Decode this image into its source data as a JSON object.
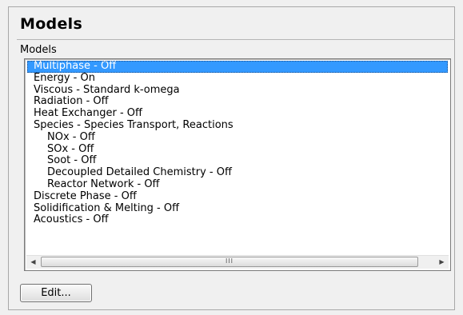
{
  "panel": {
    "title": "Models",
    "group_label": "Models"
  },
  "models_list": {
    "items": [
      {
        "label": "Multiphase - Off",
        "indent": 0,
        "selected": true
      },
      {
        "label": "Energy - On",
        "indent": 0,
        "selected": false
      },
      {
        "label": "Viscous - Standard k-omega",
        "indent": 0,
        "selected": false
      },
      {
        "label": "Radiation - Off",
        "indent": 0,
        "selected": false
      },
      {
        "label": "Heat Exchanger - Off",
        "indent": 0,
        "selected": false
      },
      {
        "label": "Species - Species Transport, Reactions",
        "indent": 0,
        "selected": false
      },
      {
        "label": "NOx - Off",
        "indent": 1,
        "selected": false
      },
      {
        "label": "SOx - Off",
        "indent": 1,
        "selected": false
      },
      {
        "label": "Soot - Off",
        "indent": 1,
        "selected": false
      },
      {
        "label": "Decoupled Detailed Chemistry - Off",
        "indent": 1,
        "selected": false
      },
      {
        "label": "Reactor Network - Off",
        "indent": 1,
        "selected": false
      },
      {
        "label": "Discrete Phase - Off",
        "indent": 0,
        "selected": false
      },
      {
        "label": "Solidification & Melting - Off",
        "indent": 0,
        "selected": false
      },
      {
        "label": "Acoustics - Off",
        "indent": 0,
        "selected": false
      }
    ]
  },
  "scrollbar": {
    "left_icon": "arrow-left-icon",
    "right_icon": "arrow-right-icon",
    "left_glyph": "◀",
    "right_glyph": "▶",
    "grip": "III"
  },
  "buttons": {
    "edit_label": "Edit..."
  },
  "colors": {
    "selection": "#3399ff",
    "background": "#f0f0f0"
  }
}
